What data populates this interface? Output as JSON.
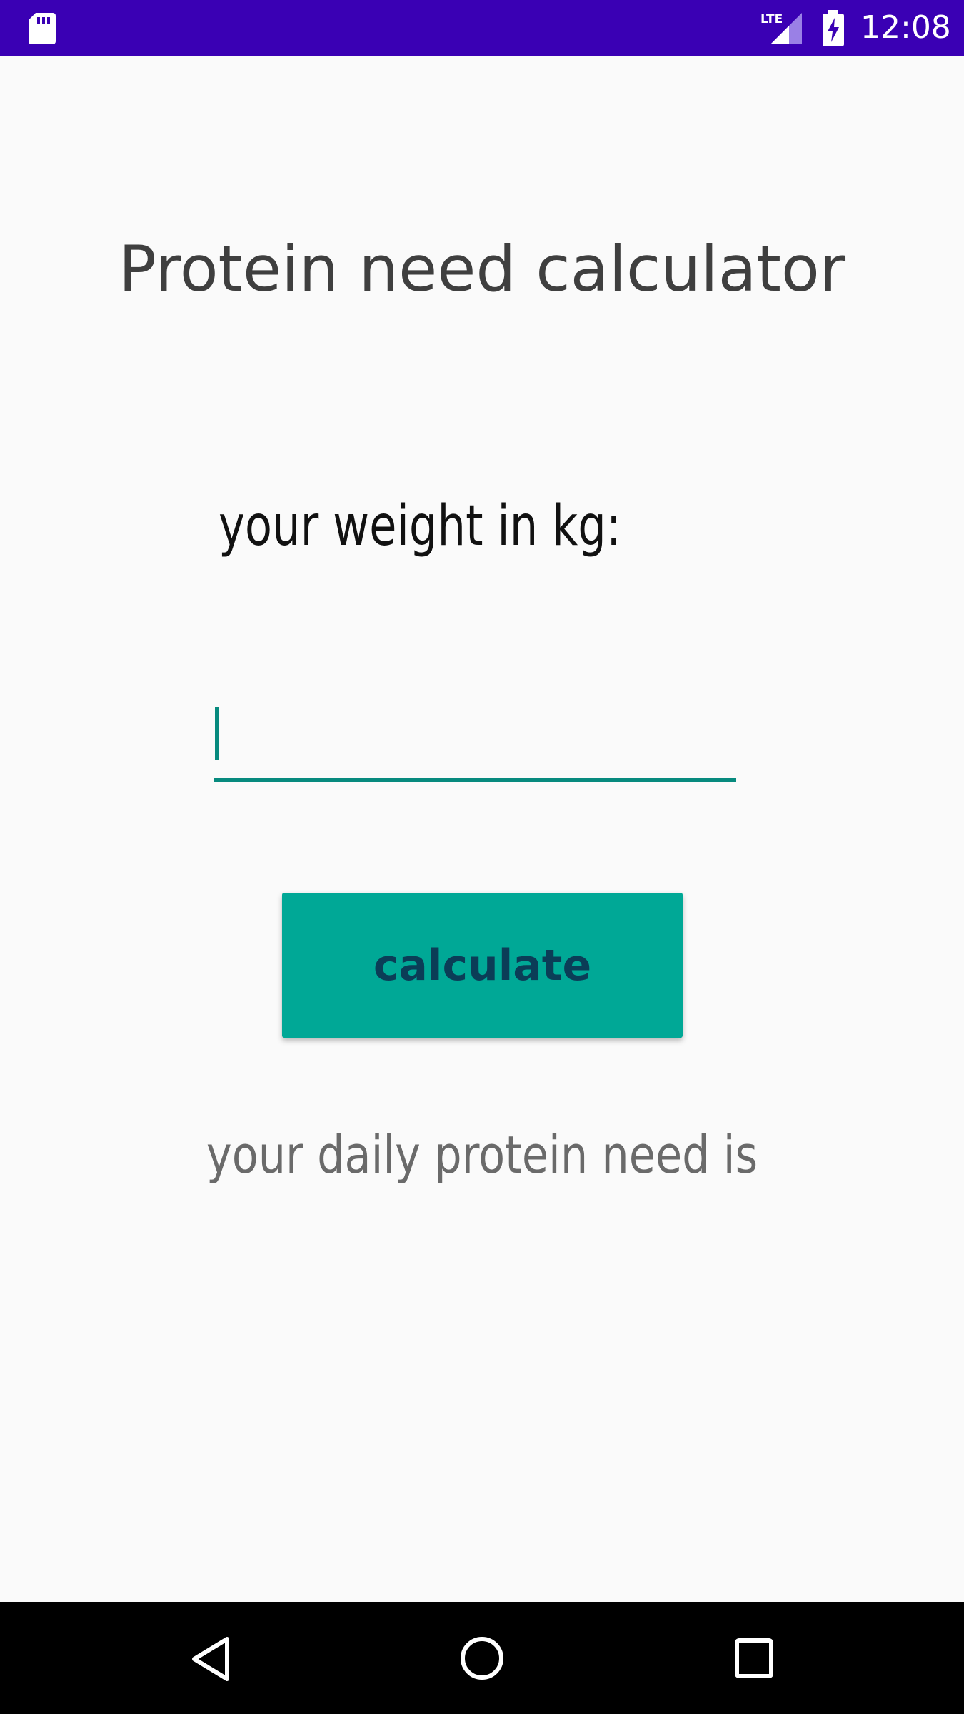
{
  "status_bar": {
    "time": "12:08",
    "network_label": "LTE",
    "sd_icon": "sd-card-icon",
    "signal_icon": "lte-signal-icon",
    "battery_icon": "battery-charging-icon"
  },
  "app": {
    "title": "Protein need calculator",
    "weight_label": "your weight in kg:",
    "weight_input_value": "",
    "calculate_label": "calculate",
    "result_text": "your daily protein need is"
  },
  "nav_bar": {
    "back_icon": "back-triangle-icon",
    "home_icon": "home-circle-icon",
    "recents_icon": "recents-square-icon"
  },
  "colors": {
    "status_bar": "#3a00b4",
    "accent": "#078a7e",
    "button": "#00a896",
    "button_text": "#0b3d57",
    "background": "#fafafa"
  }
}
